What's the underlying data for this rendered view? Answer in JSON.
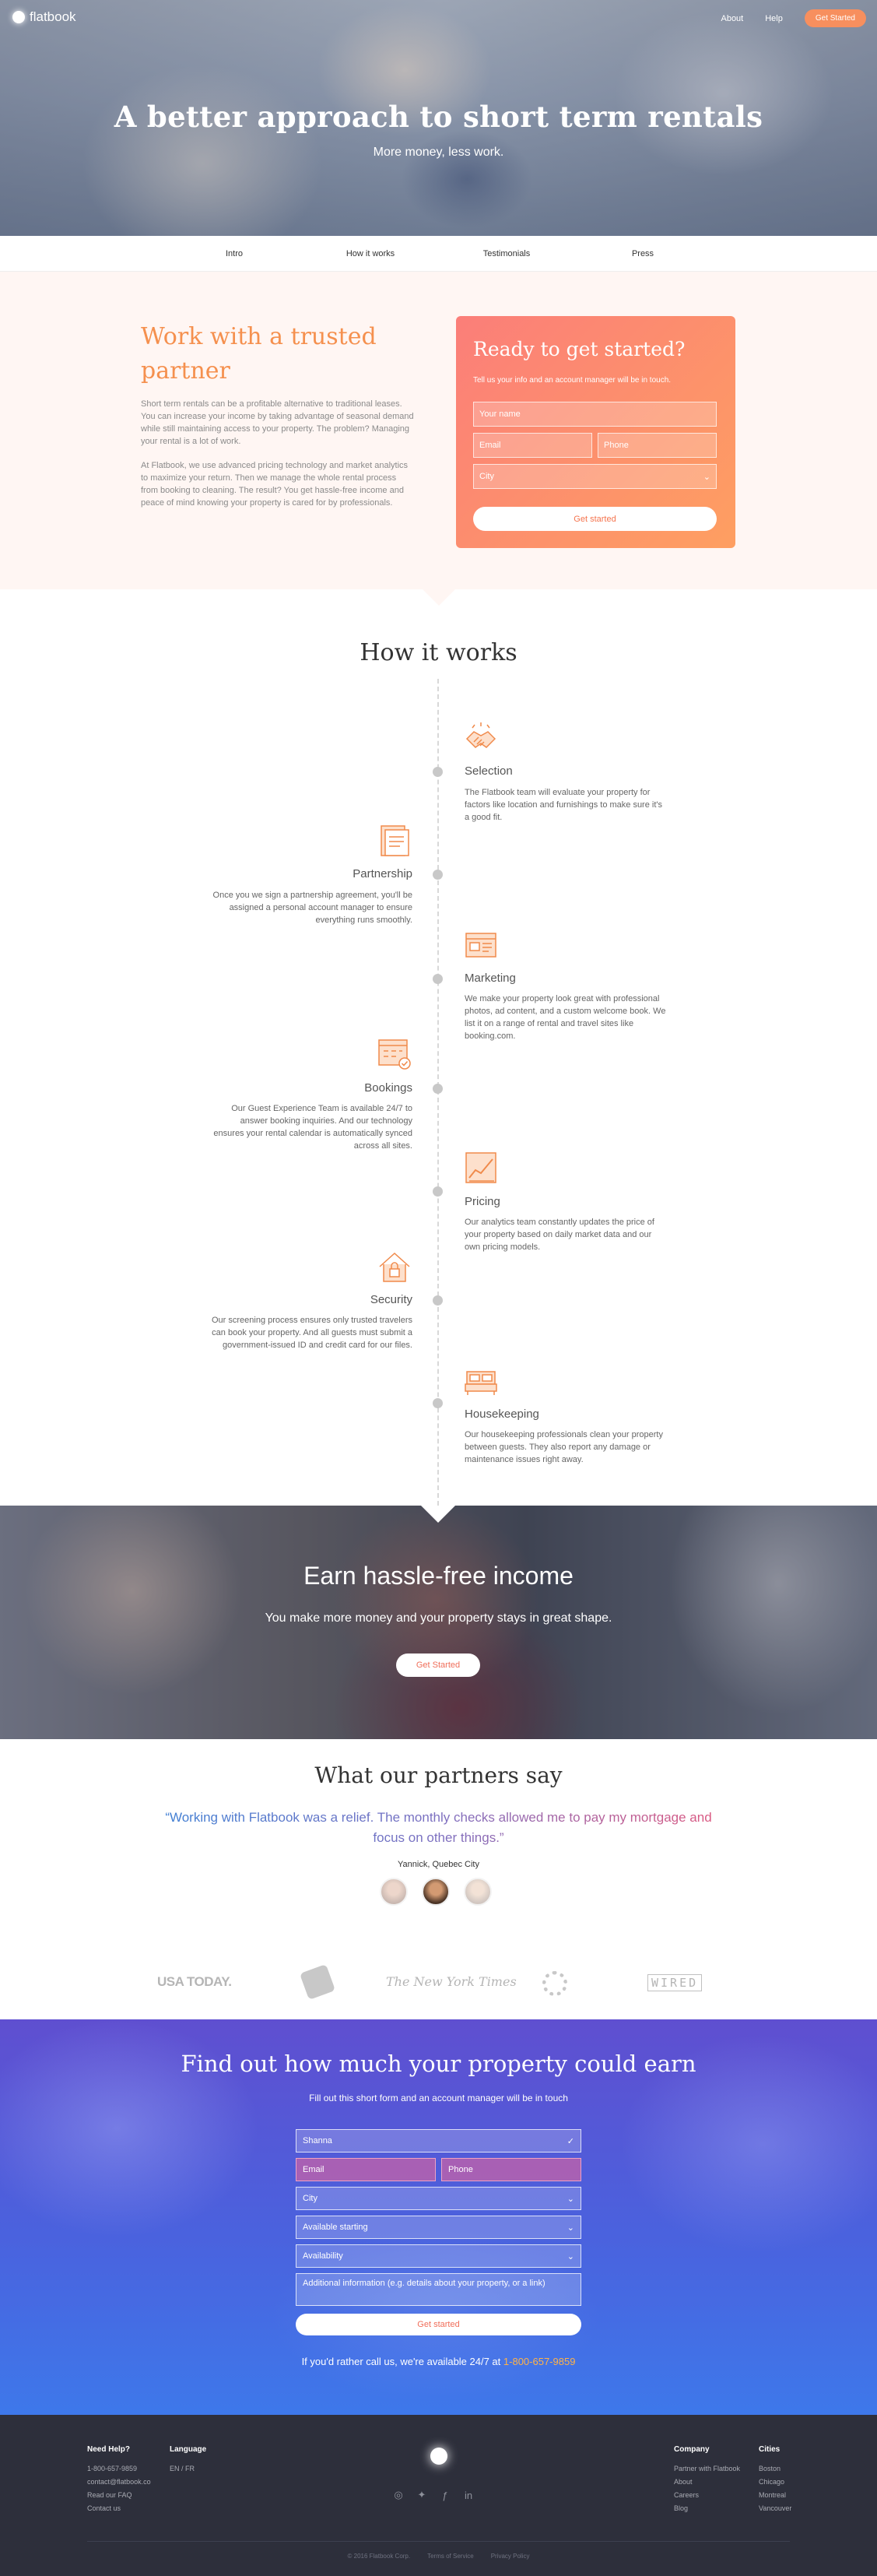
{
  "header": {
    "brand": "flatbook",
    "nav": [
      "About",
      "Help"
    ],
    "cta": "Get Started"
  },
  "hero": {
    "title": "A better approach to short term rentals",
    "subtitle": "More money, less work."
  },
  "section_nav": [
    "Intro",
    "How it works",
    "Testimonials",
    "Press"
  ],
  "trusted": {
    "title": "Work with a trusted partner",
    "p1": "Short term rentals can be a profitable alternative to traditional leases. You can increase your income by taking advantage of seasonal demand while still maintaining access to your property. The problem? Managing your rental is a lot of work.",
    "p2": "At Flatbook, we use advanced pricing technology and market analytics to maximize your return. Then we manage the whole rental process from booking to cleaning. The result? You get hassle-free income and peace of mind knowing your property is cared for by professionals."
  },
  "ready_form": {
    "title": "Ready to get started?",
    "hint": "Tell us your info and an account manager will be in touch.",
    "name_placeholder": "Your name",
    "email_placeholder": "Email",
    "phone_placeholder": "Phone",
    "city_placeholder": "City",
    "submit": "Get started"
  },
  "how": {
    "title": "How it works",
    "steps": [
      {
        "title": "Selection",
        "icon": "handshake-icon",
        "text": "The Flatbook team will evaluate your property for factors like location and furnishings to make sure it's a good fit."
      },
      {
        "title": "Partnership",
        "icon": "contract-icon",
        "text": "Once you we sign a partnership agreement, you'll be assigned a personal account manager to ensure everything runs smoothly."
      },
      {
        "title": "Marketing",
        "icon": "listing-icon",
        "text": "We make your property look great with professional photos, ad content, and a custom welcome book. We list it on a range of rental and travel sites like booking.com."
      },
      {
        "title": "Bookings",
        "icon": "calendar-check-icon",
        "text": "Our Guest Experience Team is available 24/7 to answer booking inquiries. And our technology ensures your rental calendar is automatically synced across all sites."
      },
      {
        "title": "Pricing",
        "icon": "chart-icon",
        "text": "Our analytics team constantly updates the price of your property based on daily market data and our own pricing models."
      },
      {
        "title": "Security",
        "icon": "house-lock-icon",
        "text": "Our screening process ensures only trusted travelers can book your property. And all guests must submit a government-issued ID and credit card for our files."
      },
      {
        "title": "Housekeeping",
        "icon": "bed-icon",
        "text": "Our housekeeping professionals clean your property between guests. They also report any damage or maintenance issues right away."
      }
    ]
  },
  "earn": {
    "title": "Earn hassle-free income",
    "subtitle": "You make more money and your property stays in great shape.",
    "cta": "Get Started"
  },
  "partners": {
    "title": "What our partners say",
    "quote": "“Working with Flatbook was a relief. The monthly checks allowed me to pay my mortgage and focus on other things.”",
    "author": "Yannick, Quebec City"
  },
  "press": [
    "USA TODAY.",
    "The New York Times",
    "WIRED"
  ],
  "find_form": {
    "title": "Find out how much your property could earn",
    "subtitle": "Fill out this short form and an account manager will be in touch",
    "name_value": "Shanna",
    "email_placeholder": "Email",
    "phone_placeholder": "Phone",
    "city_placeholder": "City",
    "available_placeholder": "Available starting",
    "availability_placeholder": "Availability",
    "info_placeholder": "Additional information (e.g. details about your property, or a link)",
    "submit": "Get started",
    "call_text": "If you'd rather call us, we're available 24/7 at",
    "phone": "1-800-657-9859"
  },
  "footer": {
    "help_title": "Need Help?",
    "help_items": [
      "1-800-657-9859",
      "contact@flatbook.co",
      "Read our FAQ",
      "Contact us"
    ],
    "lang_title": "Language",
    "lang_items": [
      "EN / FR"
    ],
    "company_title": "Company",
    "company_items": [
      "Partner with Flatbook",
      "About",
      "Careers",
      "Blog"
    ],
    "cities_title": "Cities",
    "cities_items": [
      "Boston",
      "Chicago",
      "Montreal",
      "Vancouver"
    ],
    "copyright": "© 2016 Flatbook Corp.",
    "terms": "Terms of Service",
    "privacy": "Privacy Policy"
  },
  "colors": {
    "accent": "#f78f5e",
    "form_gradient_start": "#fb7e79",
    "form_gradient_end": "#fe9f61",
    "find_gradient": "#4a62de",
    "footer": "#2d2f3b"
  }
}
